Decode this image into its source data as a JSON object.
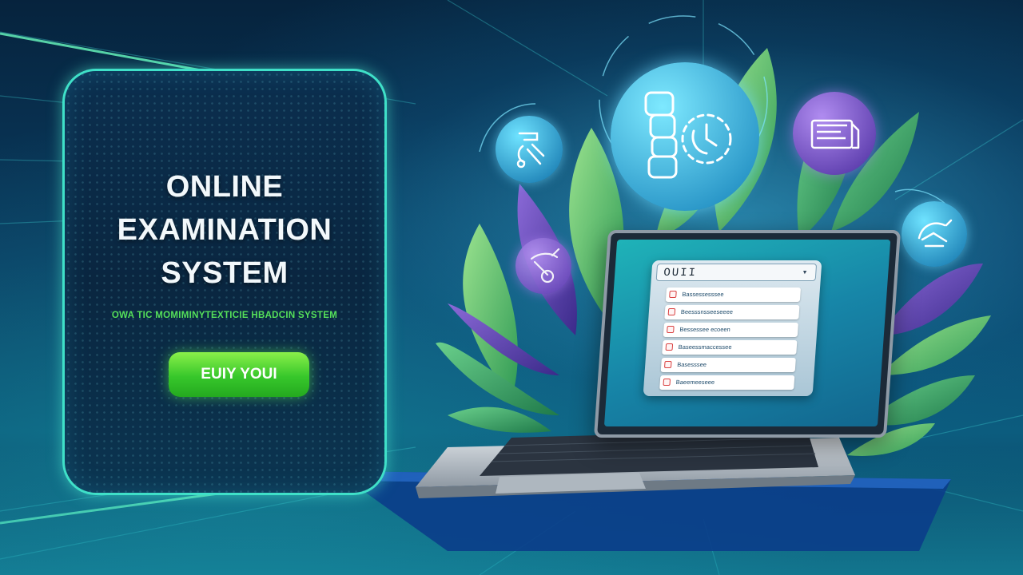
{
  "promo": {
    "title_lines": [
      "ONLINE",
      "EXAMINATION",
      "SYSTEM"
    ],
    "subtitle": "OWA TIC MOMIMINYTEXTICIE HBADCIN SYSTEM",
    "cta_label": "EUIY YOUI"
  },
  "laptop": {
    "quiz_title": "OUII",
    "questions": [
      "Bassessesssee",
      "Beesssnsseeseeee",
      "Bessessee ecoeen",
      "Baseessmaccessee",
      "Basesssee",
      "Baeemeeseee"
    ]
  },
  "icons": [
    "exam-writing-icon",
    "quiz-timer-icon",
    "document-icon",
    "student-icon",
    "checklist-icon"
  ],
  "colors": {
    "accent_green": "#3bcf2e",
    "panel_border": "#3fe0c8",
    "subtitle_green": "#55e05a",
    "bubble_purple": "#7a4fc4",
    "bubble_cyan": "#1fb9d6"
  }
}
